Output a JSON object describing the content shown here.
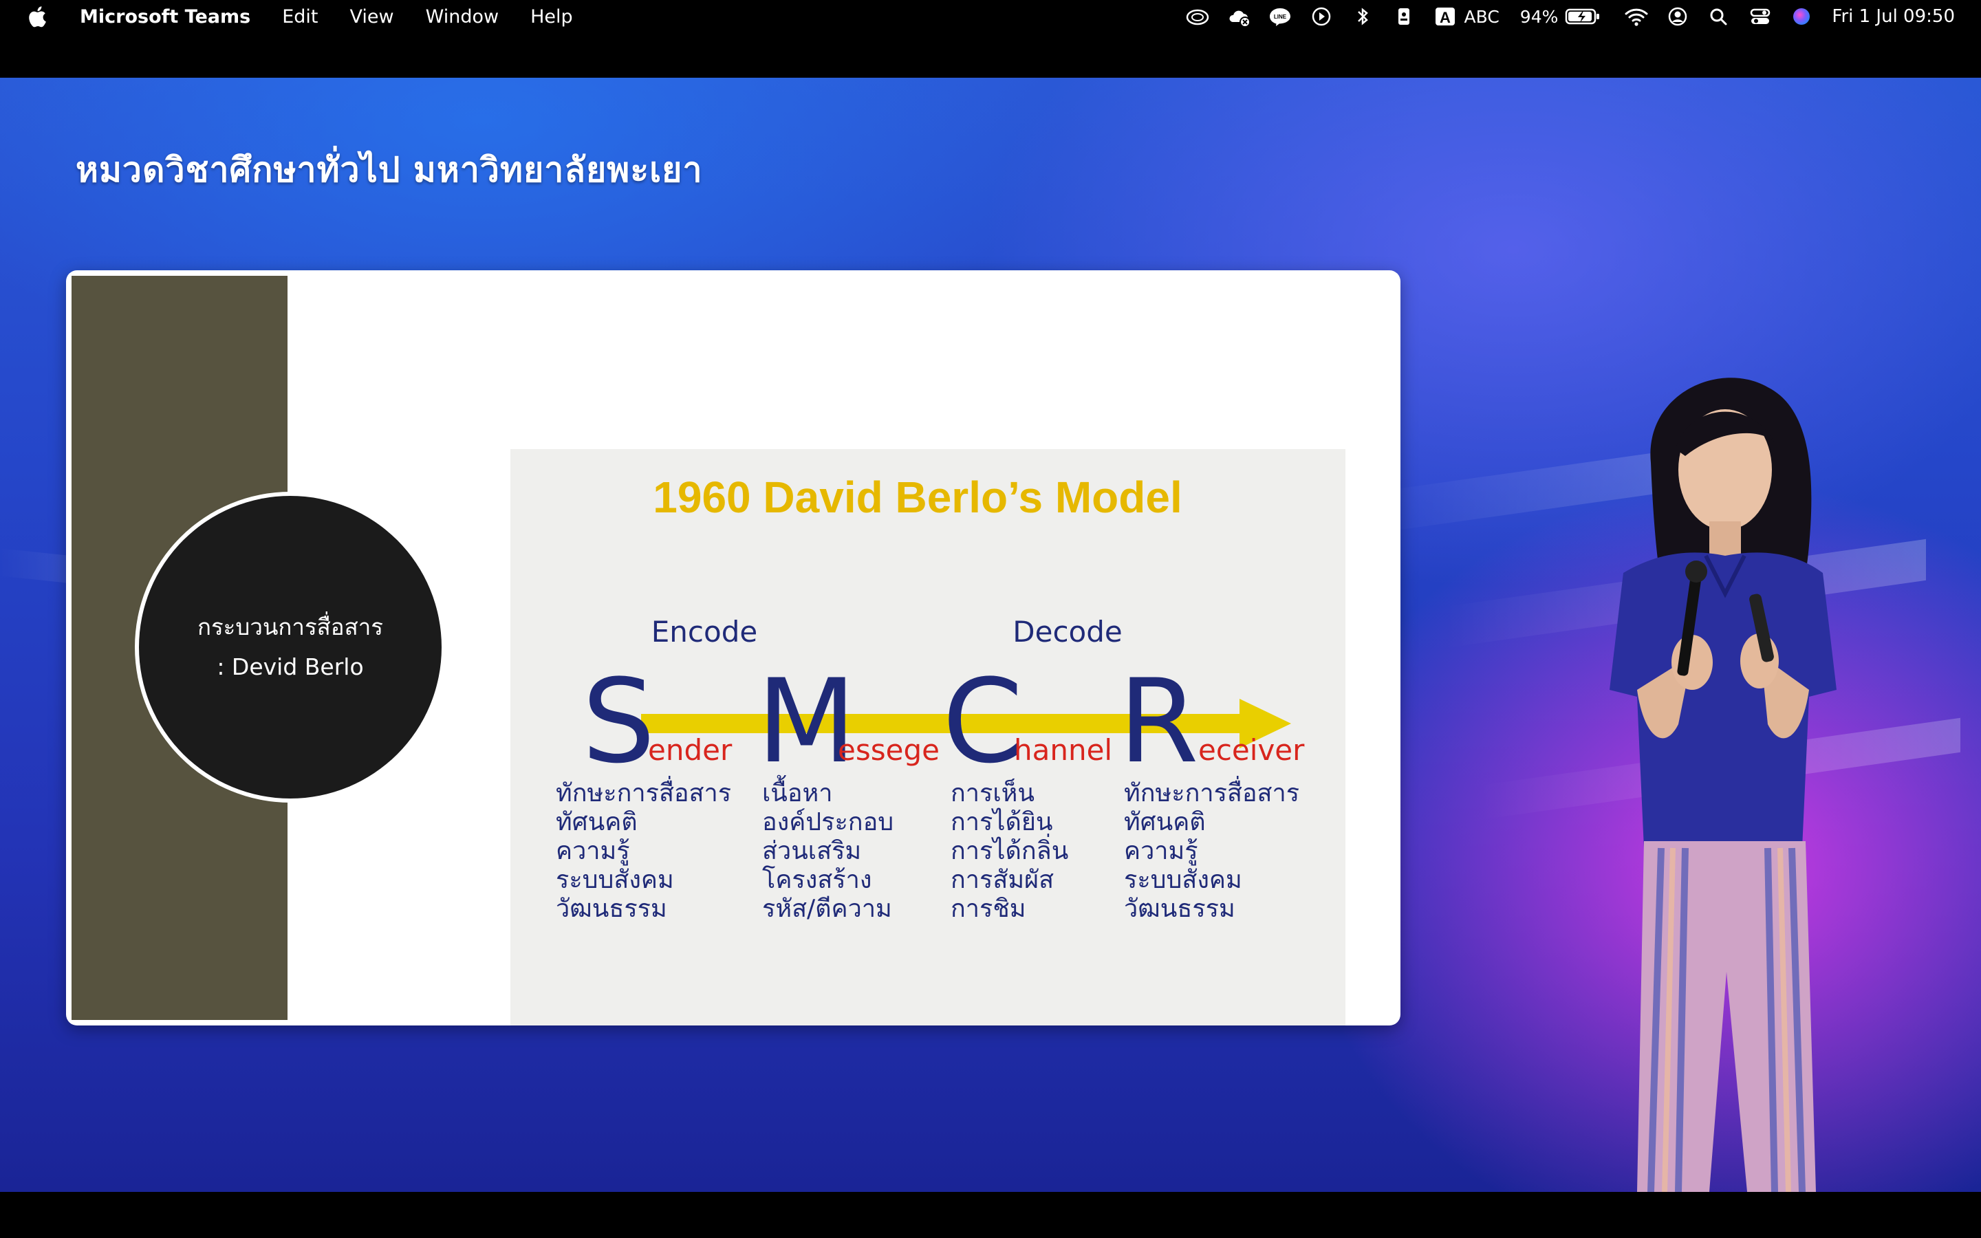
{
  "menubar": {
    "app_name": "Microsoft Teams",
    "menus": [
      "Edit",
      "View",
      "Window",
      "Help"
    ],
    "status": {
      "keyboard_input": "ABC",
      "battery": "94%",
      "clock": "Fri 1 Jul  09:50"
    }
  },
  "stage": {
    "title": "หมวดวิชาศึกษาทั่วไป มหาวิทยาลัยพะเยา"
  },
  "slide": {
    "topic_line1": "กระบวนการสื่อสาร",
    "topic_line2": ": Devid Berlo",
    "model_title": "1960 David Berlo’s Model",
    "encode_label": "Encode",
    "decode_label": "Decode",
    "components": [
      {
        "initial": "S",
        "rest": "ender",
        "items": [
          "ทักษะการสื่อสาร",
          "ทัศนคติ",
          "ความรู้",
          "ระบบสังคม",
          "วัฒนธรรม"
        ]
      },
      {
        "initial": "M",
        "rest": "essege",
        "items": [
          "เนื้อหา",
          "องค์ประกอบ",
          "ส่วนเสริม",
          "โครงสร้าง",
          "รหัส/ตีความ"
        ]
      },
      {
        "initial": "C",
        "rest": "hannel",
        "items": [
          "การเห็น",
          "การได้ยิน",
          "การได้กลิ่น",
          "การสัมผัส",
          "การชิม"
        ]
      },
      {
        "initial": "R",
        "rest": "eceiver",
        "items": [
          "ทักษะการสื่อสาร",
          "ทัศนคติ",
          "ความรู้",
          "ระบบสังคม",
          "วัฒนธรรม"
        ]
      }
    ],
    "colors": {
      "title": "#e6b800",
      "initial": "#1f2a78",
      "rest": "#d8251d",
      "arrow": "#e9cf00",
      "items": "#1f2a78"
    }
  }
}
